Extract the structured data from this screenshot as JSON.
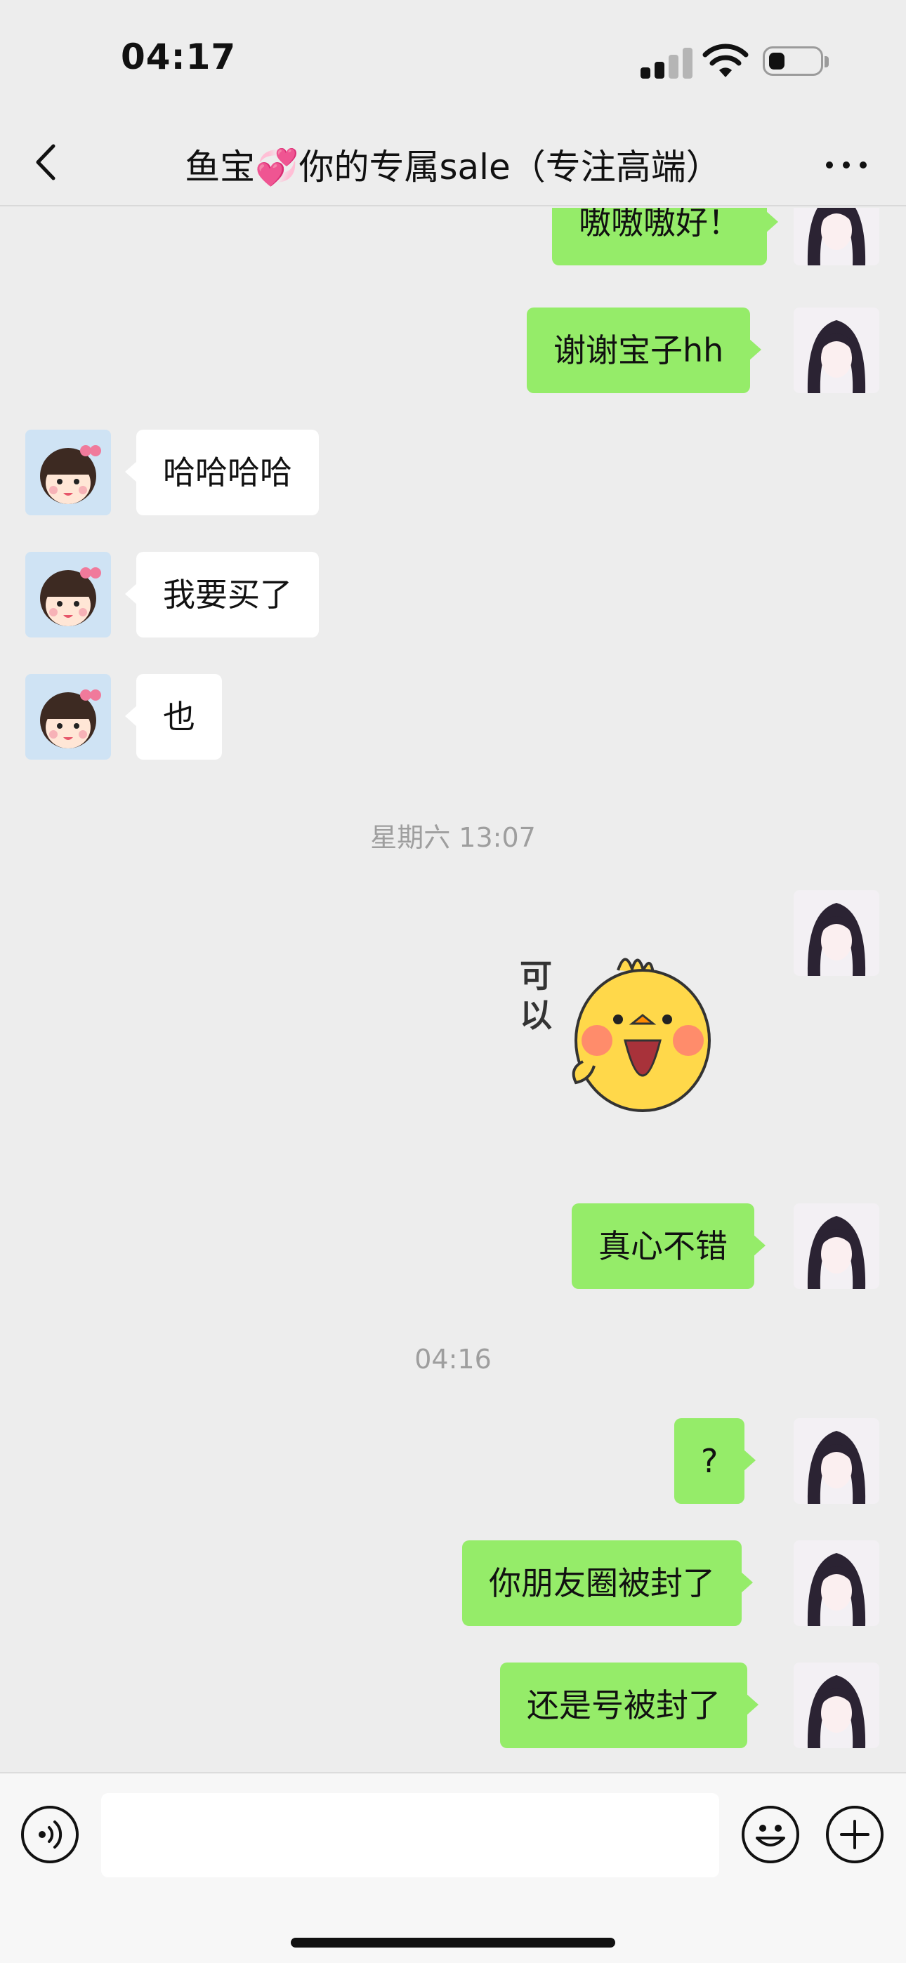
{
  "status_bar": {
    "time": "04:17"
  },
  "header": {
    "title": "鱼宝💞你的专属sale（专注高端）"
  },
  "messages": [
    {
      "side": "out",
      "text": "嗷嗷嗷好！"
    },
    {
      "side": "out",
      "text": "谢谢宝子hh"
    },
    {
      "side": "in",
      "text": "哈哈哈哈"
    },
    {
      "side": "in",
      "text": "我要买了"
    },
    {
      "side": "in",
      "text": "也"
    },
    {
      "side": "out",
      "text": "真心不错"
    },
    {
      "side": "out",
      "text": "?"
    },
    {
      "side": "out",
      "text": "你朋友圈被封了"
    },
    {
      "side": "out",
      "text": "还是号被封了"
    }
  ],
  "timestamps": [
    "星期六 13:07",
    "04:16"
  ],
  "sticker": {
    "text": "可以",
    "icon": "chick-sticker"
  },
  "input_bar": {
    "placeholder": ""
  },
  "colors": {
    "outgoing": "#95ec69",
    "incoming": "#ffffff",
    "background": "#ededed"
  },
  "icons": [
    "back-chevron-icon",
    "more-dots-icon",
    "voice-icon",
    "emoji-icon",
    "plus-icon"
  ]
}
